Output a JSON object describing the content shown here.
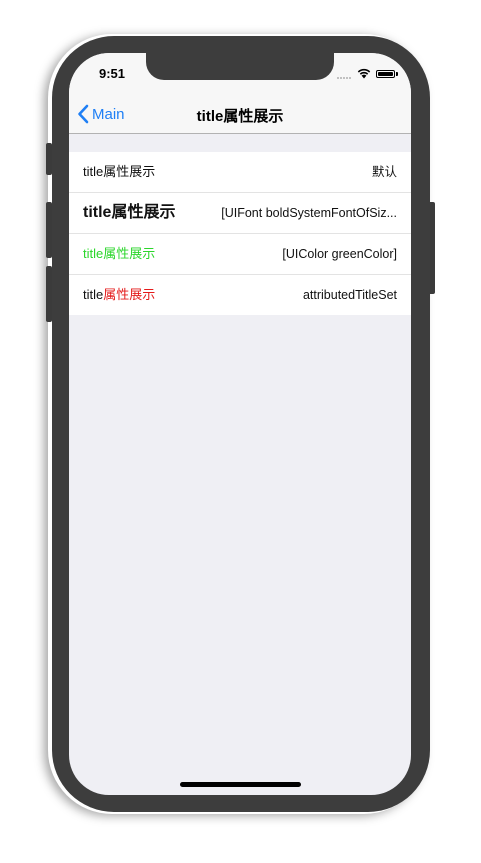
{
  "statusbar": {
    "time": "9:51"
  },
  "navbar": {
    "back_label": "Main",
    "title": "title属性展示"
  },
  "rows": [
    {
      "title": "title属性展示",
      "detail": "默认"
    },
    {
      "title": "title属性展示",
      "detail": "[UIFont boldSystemFontOfSiz..."
    },
    {
      "title": "title属性展示",
      "detail": "[UIColor greenColor]"
    },
    {
      "title_prefix": "title",
      "title_suffix": "属性展示",
      "detail": "attributedTitleSet"
    }
  ],
  "colors": {
    "tint": "#1f7ff5",
    "green_title": "#2bd62b",
    "red_title": "#e41b1b"
  },
  "icons": [
    "chevron-left-icon",
    "cellular-signal-icon",
    "wifi-icon",
    "battery-icon"
  ]
}
